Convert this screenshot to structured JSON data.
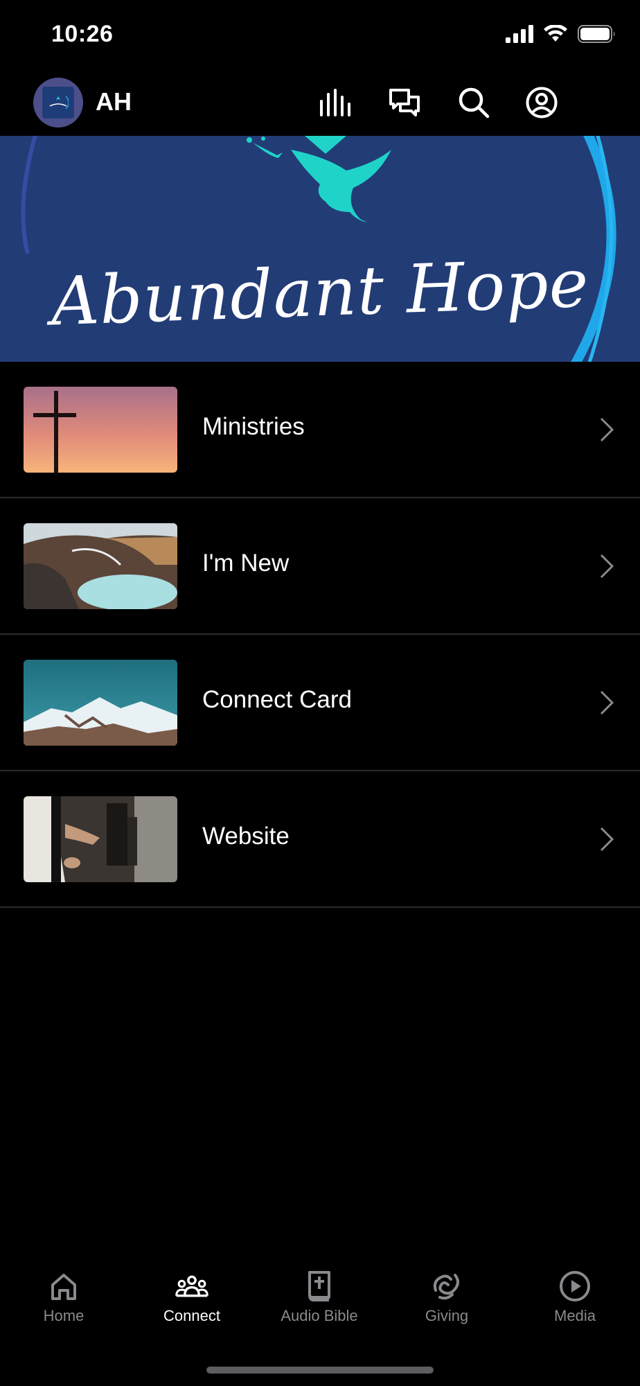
{
  "status_bar": {
    "time": "10:26"
  },
  "header": {
    "app_name": "AH",
    "icons": [
      "stats-icon",
      "chat-icon",
      "search-icon",
      "profile-icon"
    ]
  },
  "banner": {
    "title": "Abundant Hope"
  },
  "menu": {
    "items": [
      {
        "label": "Ministries",
        "thumbnail": "cross-sunset"
      },
      {
        "label": "I'm New",
        "thumbnail": "crater-lake"
      },
      {
        "label": "Connect Card",
        "thumbnail": "snowy-mountains"
      },
      {
        "label": "Website",
        "thumbnail": "worship-hands"
      }
    ]
  },
  "tabs": [
    {
      "label": "Home",
      "icon": "home-icon",
      "active": false
    },
    {
      "label": "Connect",
      "icon": "people-icon",
      "active": true
    },
    {
      "label": "Audio Bible",
      "icon": "bible-icon",
      "active": false
    },
    {
      "label": "Giving",
      "icon": "giving-icon",
      "active": false
    },
    {
      "label": "Media",
      "icon": "play-icon",
      "active": false
    }
  ],
  "colors": {
    "background": "#000000",
    "banner": "#223c76",
    "accent": "#1fd3c8",
    "tab_inactive": "#8a8a8e"
  }
}
